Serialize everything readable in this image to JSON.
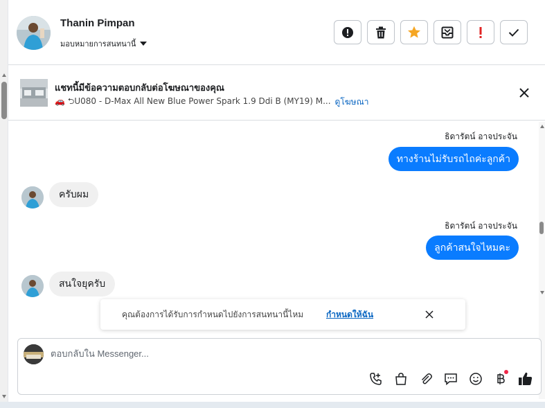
{
  "header": {
    "contact_name": "Thanin Pimpan",
    "assign_label": "มอบหมายการสนทนานี้",
    "actions": [
      {
        "name": "report",
        "icon": "alert-circle-icon"
      },
      {
        "name": "delete",
        "icon": "trash-icon"
      },
      {
        "name": "star",
        "icon": "star-icon",
        "color": "#f5a623"
      },
      {
        "name": "archive",
        "icon": "inbox-icon"
      },
      {
        "name": "spam",
        "icon": "exclamation-icon",
        "color": "#e02424"
      },
      {
        "name": "done",
        "icon": "check-icon"
      }
    ]
  },
  "ad_banner": {
    "title": "แชทนี้มีข้อความตอบกลับต่อโฆษณาของคุณ",
    "subtitle": "🚗 ⮌U080 - D-Max All New Blue Power Spark 1.9 Ddi B (MY19) M...",
    "link": "ดูโฆษณา"
  },
  "messages": [
    {
      "direction": "out",
      "sender": "ธิดารัตน์ อาจประจัน",
      "text": "ทางร้านไม่รับรถไถค่ะลูกค้า"
    },
    {
      "direction": "in",
      "text": "ครับผม"
    },
    {
      "direction": "out",
      "sender": "ธิดารัตน์ อาจประจัน",
      "text": "ลูกค้าสนใจไหมคะ"
    },
    {
      "direction": "in",
      "text": "สนใจยุครับ"
    }
  ],
  "notification_prompt": {
    "text": "คุณต้องการได้รับการกำหนดไปยังการสนทนานี้ไหม",
    "link": "กำหนดให้ฉัน"
  },
  "composer": {
    "placeholder": "ตอบกลับใน Messenger...",
    "tools": [
      "phone-plus-icon",
      "shopping-bag-icon",
      "paperclip-icon",
      "chat-bubble-icon",
      "smiley-icon",
      "baht-icon",
      "thumbs-up-icon"
    ]
  },
  "colors": {
    "accent": "#0a7cff",
    "link": "#0a66c2",
    "incoming_bubble": "#f0f0f0",
    "star": "#f5a623",
    "spam": "#e02424"
  }
}
